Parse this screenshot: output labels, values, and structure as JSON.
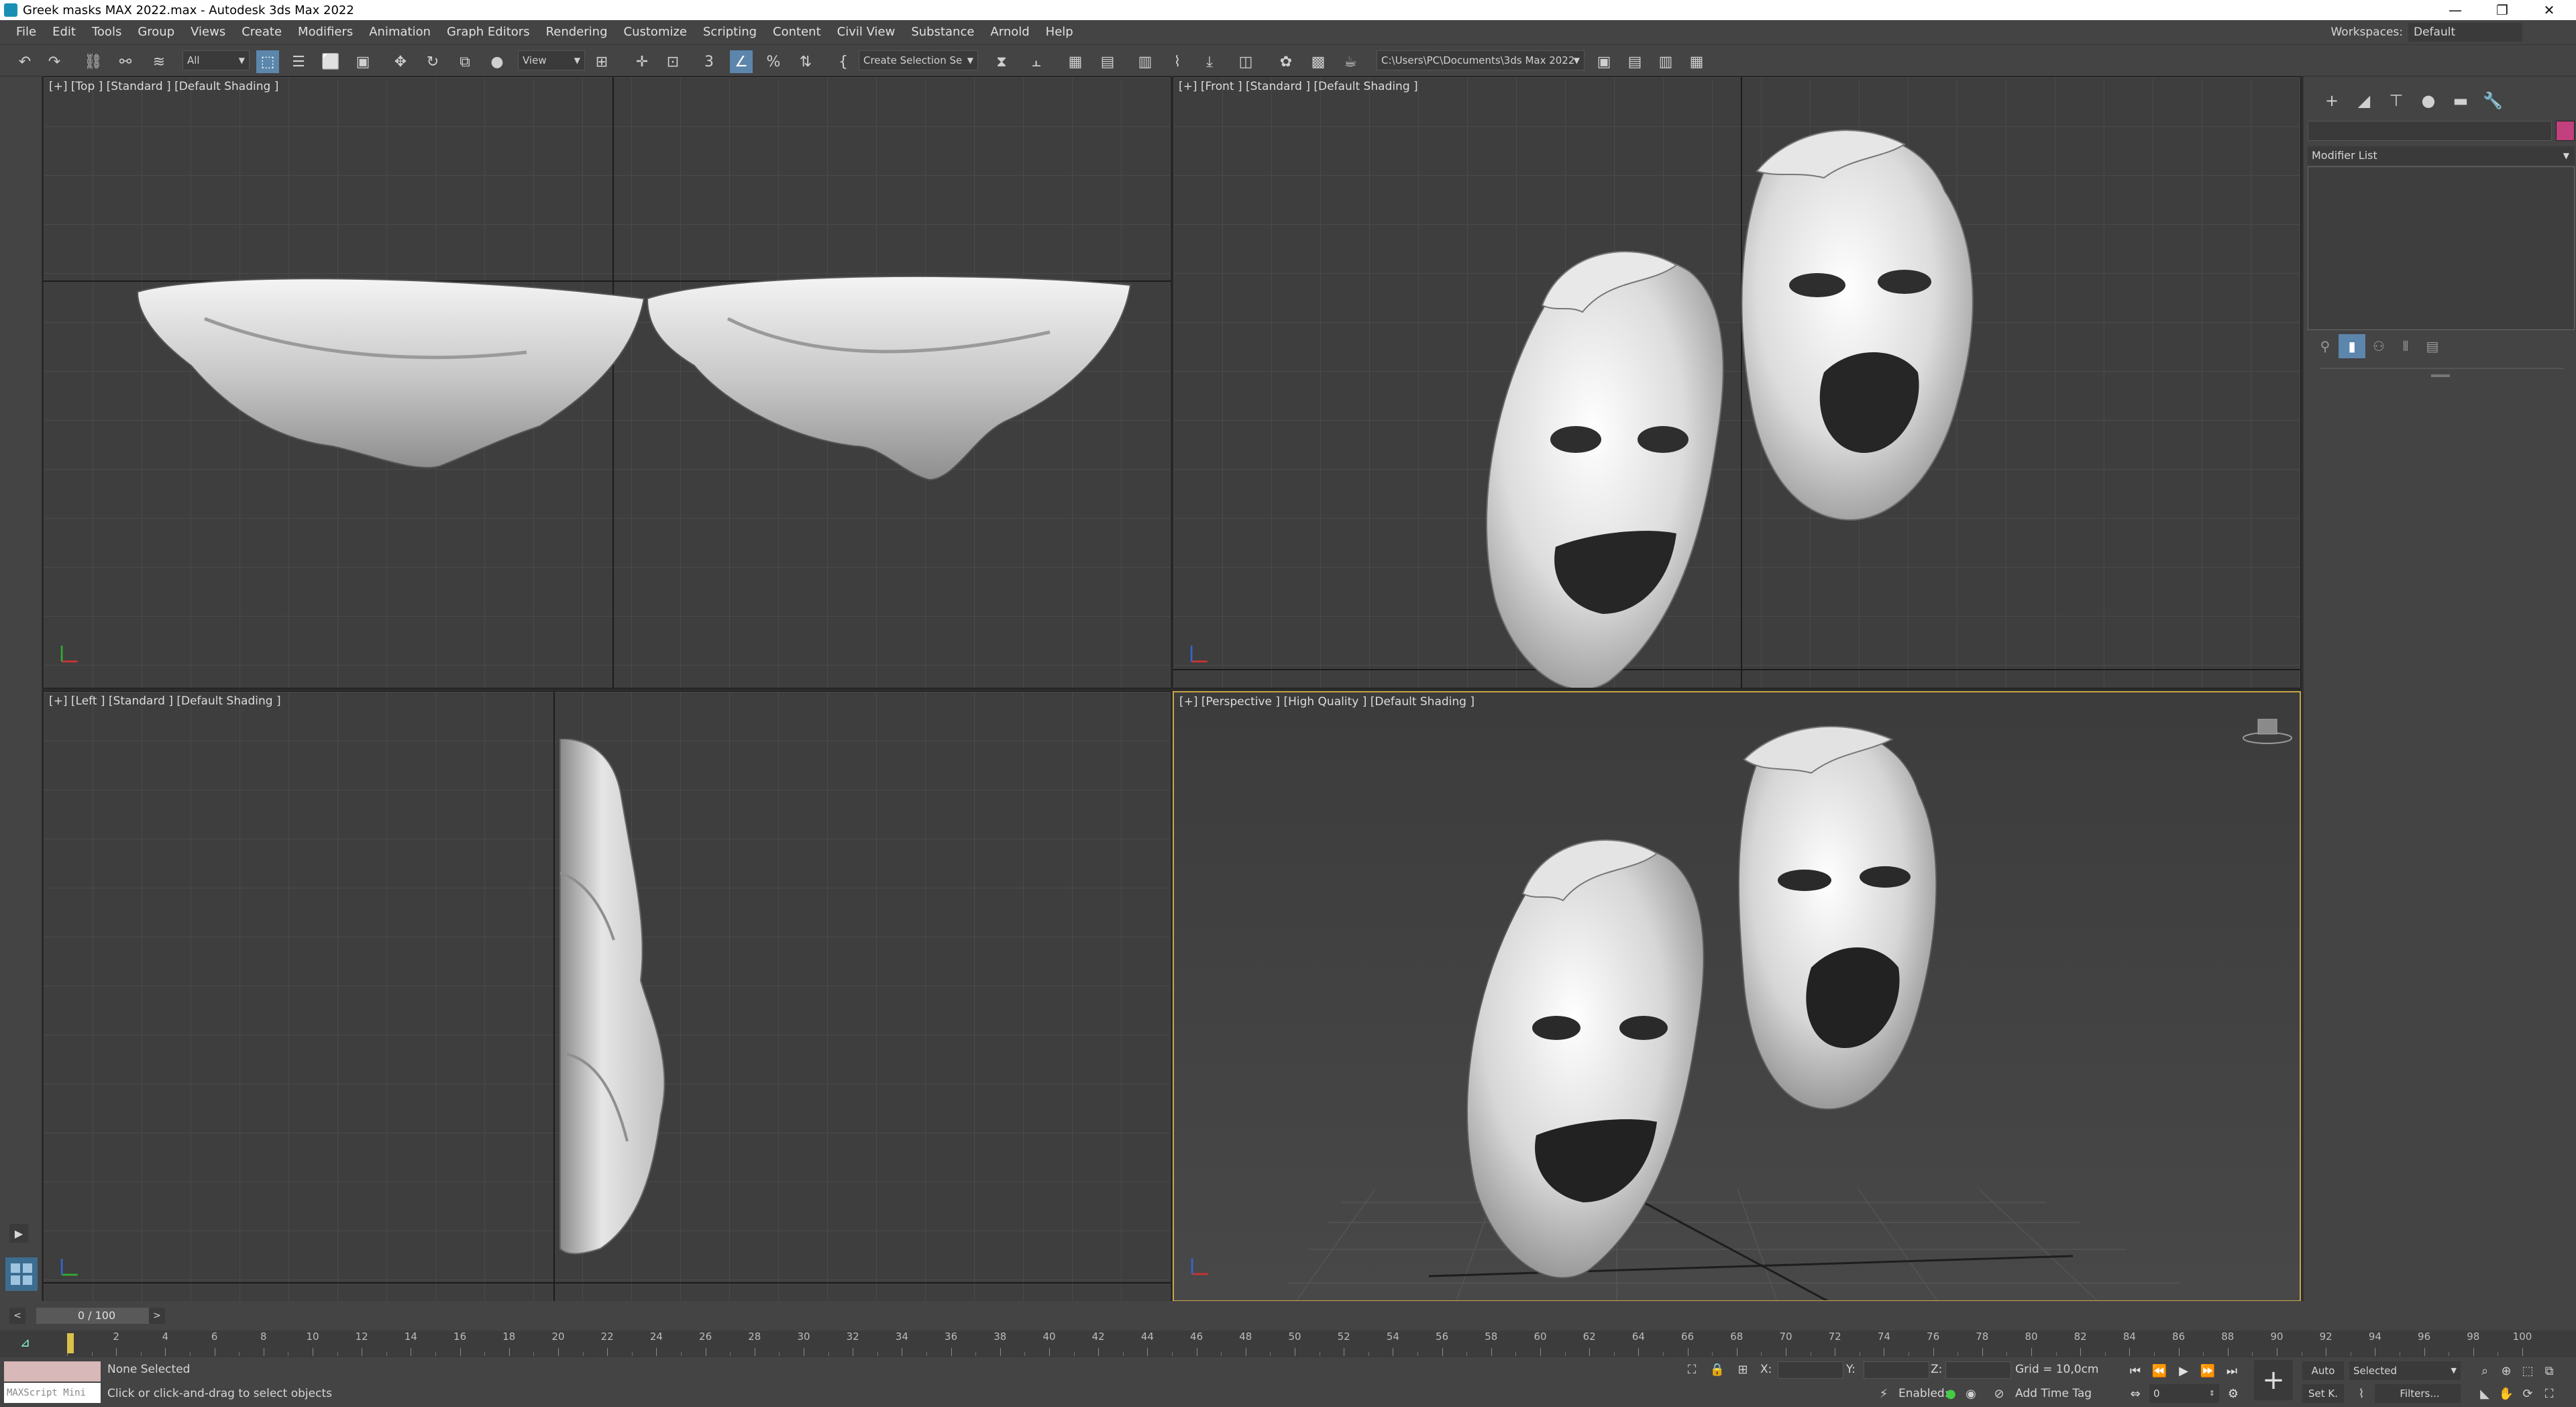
{
  "window": {
    "title": "Greek masks MAX 2022.max - Autodesk 3ds Max 2022",
    "controls": [
      "—",
      "❐",
      "✕"
    ]
  },
  "menubar": {
    "items": [
      "File",
      "Edit",
      "Tools",
      "Group",
      "Views",
      "Create",
      "Modifiers",
      "Animation",
      "Graph Editors",
      "Rendering",
      "Customize",
      "Scripting",
      "Content",
      "Civil View",
      "Substance",
      "Arnold",
      "Help"
    ],
    "workspaces_label": "Workspaces:",
    "workspaces_value": "Default"
  },
  "toolbar": {
    "selection_filter": "All",
    "ref_coord": "View",
    "named_selection": "Create Selection Se",
    "project_path": "C:\\Users\\PC\\Documents\\3ds Max 2022",
    "snap_label": "3"
  },
  "viewports": {
    "top": {
      "label": "[+] [Top ] [Standard ] [Default Shading ]"
    },
    "front": {
      "label": "[+] [Front ] [Standard ] [Default Shading ]"
    },
    "left": {
      "label": "[+] [Left ] [Standard ] [Default Shading ]"
    },
    "perspective": {
      "label": "[+] [Perspective ] [High Quality ] [Default Shading ]"
    }
  },
  "command_panel": {
    "modifier_list": "Modifier List",
    "swatch_color": "#c2407e"
  },
  "time_slider": {
    "frame": "0 / 100",
    "prev": "<",
    "next": ">"
  },
  "trackbar": {
    "ticks": [
      0,
      2,
      4,
      6,
      8,
      10,
      12,
      14,
      16,
      18,
      20,
      22,
      24,
      26,
      28,
      30,
      32,
      34,
      36,
      38,
      40,
      42,
      44,
      46,
      48,
      50,
      52,
      54,
      56,
      58,
      60,
      62,
      64,
      66,
      68,
      70,
      72,
      74,
      76,
      78,
      80,
      82,
      84,
      86,
      88,
      90,
      92,
      94,
      96,
      98,
      100
    ],
    "labels": [
      "2",
      "4",
      "6",
      "8",
      "10",
      "12",
      "14",
      "16",
      "18",
      "20",
      "22",
      "24",
      "26",
      "28",
      "30",
      "32",
      "34",
      "36",
      "38",
      "40",
      "42",
      "44",
      "46",
      "48",
      "50",
      "52",
      "54",
      "56",
      "58",
      "60",
      "62",
      "64",
      "66",
      "68",
      "70",
      "72",
      "74",
      "76",
      "78",
      "80",
      "82",
      "84",
      "86",
      "88",
      "90",
      "92",
      "94",
      "96",
      "98",
      "100"
    ]
  },
  "statusbar": {
    "maxscript_label": "MAXScript Mini",
    "selection": "None Selected",
    "prompt": "Click or click-and-drag to select objects",
    "x_label": "X:",
    "y_label": "Y:",
    "z_label": "Z:",
    "grid": "Grid = 10,0cm",
    "enabled_label": "Enabled:",
    "add_time_tag": "Add Time Tag",
    "auto": "Auto",
    "set_key": "Set K.",
    "selected": "Selected",
    "frame_field": "0",
    "filters": "Filters..."
  }
}
